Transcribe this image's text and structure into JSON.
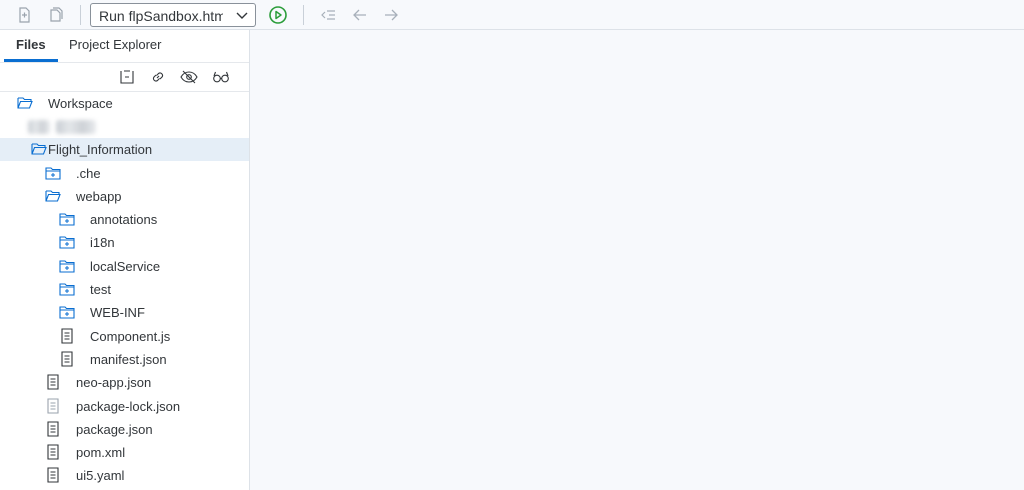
{
  "toolbar": {
    "run_config": "Run flpSandbox.html",
    "icons": [
      "new-file-icon",
      "new-folder-icon",
      "chevron-down-icon",
      "run-icon",
      "indent-icon",
      "back-icon",
      "forward-icon"
    ],
    "colors": {
      "run": "#2b9d3a",
      "accent": "#0a6ed1"
    }
  },
  "panel": {
    "tabs": [
      {
        "label": "Files",
        "active": true
      },
      {
        "label": "Project Explorer",
        "active": false
      }
    ],
    "actions": [
      "collapse-all-icon",
      "link-icon",
      "hide-icon",
      "glasses-icon"
    ]
  },
  "tree": {
    "workspace": "Workspace",
    "project": "Flight_Information",
    "che": ".che",
    "webapp": "webapp",
    "annotations": "annotations",
    "i18n": "i18n",
    "localService": "localService",
    "test": "test",
    "webinf": "WEB-INF",
    "component": "Component.js",
    "manifest": "manifest.json",
    "neoapp": "neo-app.json",
    "packagelock": "package-lock.json",
    "package": "package.json",
    "pom": "pom.xml",
    "ui5": "ui5.yaml"
  }
}
